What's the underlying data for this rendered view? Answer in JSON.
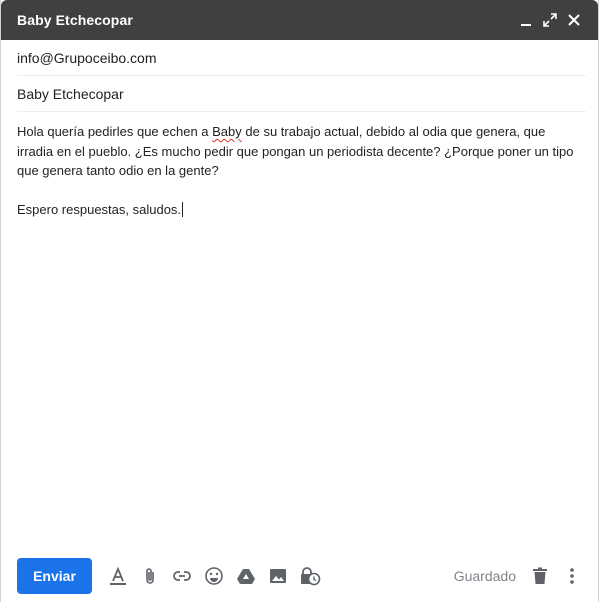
{
  "window": {
    "title": "Baby Etchecopar",
    "controls": [
      "minimize-icon",
      "pop-out-icon",
      "close-icon"
    ]
  },
  "recipients": {
    "to": "info@Grupoceibo.com"
  },
  "subject": "Baby Etchecopar",
  "body": {
    "paragraph1_before": "Hola quería pedirles que echen a ",
    "paragraph1_misspelled": "Baby",
    "paragraph1_after": " de su trabajo actual, debido al odia que genera, que irradia en el pueblo. ¿Es mucho pedir que pongan un periodista decente? ¿Porque poner un tipo que genera tanto odio en la gente?",
    "paragraph2": "Espero respuestas, saludos."
  },
  "toolbar": {
    "send_label": "Enviar",
    "status": "Guardado",
    "icons": [
      "formatting-icon",
      "attach-icon",
      "link-icon",
      "emoji-icon",
      "drive-icon",
      "photo-icon",
      "confidential-mode-icon",
      "delete-icon",
      "more-options-icon"
    ]
  },
  "colors": {
    "titlebar": "#404040",
    "send_button": "#1a73e8",
    "icon": "#5f6368",
    "status_text": "#80868b",
    "spellcheck": "#d93025"
  }
}
